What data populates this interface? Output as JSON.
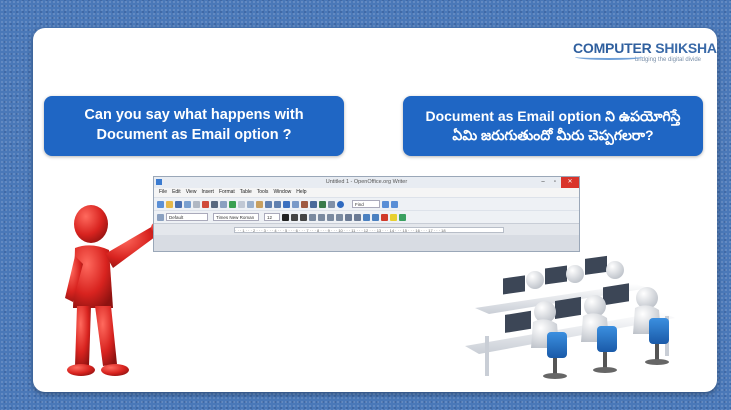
{
  "logo": {
    "name_a": "COMPUTER",
    "name_b": " SHIKSHA",
    "tagline": "bridging the digital divide"
  },
  "question_en": {
    "line1": "Can you say what happens with",
    "line2": "Document as Email option ?"
  },
  "question_te": {
    "line1": "Document as Email option ని ఉపయోగిస్తే",
    "line2": "ఏమి జరుగుతుందో మీరు చెప్పగలరా?"
  },
  "app_window": {
    "title": "Untitled 1 - OpenOffice.org Writer",
    "minimize": "–",
    "maximize": "▫",
    "close": "✕",
    "menu": [
      "File",
      "Edit",
      "View",
      "Insert",
      "Format",
      "Table",
      "Tools",
      "Window",
      "Help"
    ],
    "style_value": "Default",
    "font_value": "Times New Roman",
    "size_value": "12",
    "find_value": "Find",
    "ruler_text": "· · · 1 · · · 2 · · · 3 · · · 4 · · · 5 · · · 6 · · · 7 · · · 8 · · · 9 · · · 10 · · · 11 · · · 12 · · · 13 · · · 14 · · · 15 · · · 16 · · · 17 · · · 18"
  },
  "colors": {
    "background": "#4a78b8",
    "callout": "#1f66c4",
    "figure": "#d8231f",
    "logo": "#2f5f9e"
  }
}
